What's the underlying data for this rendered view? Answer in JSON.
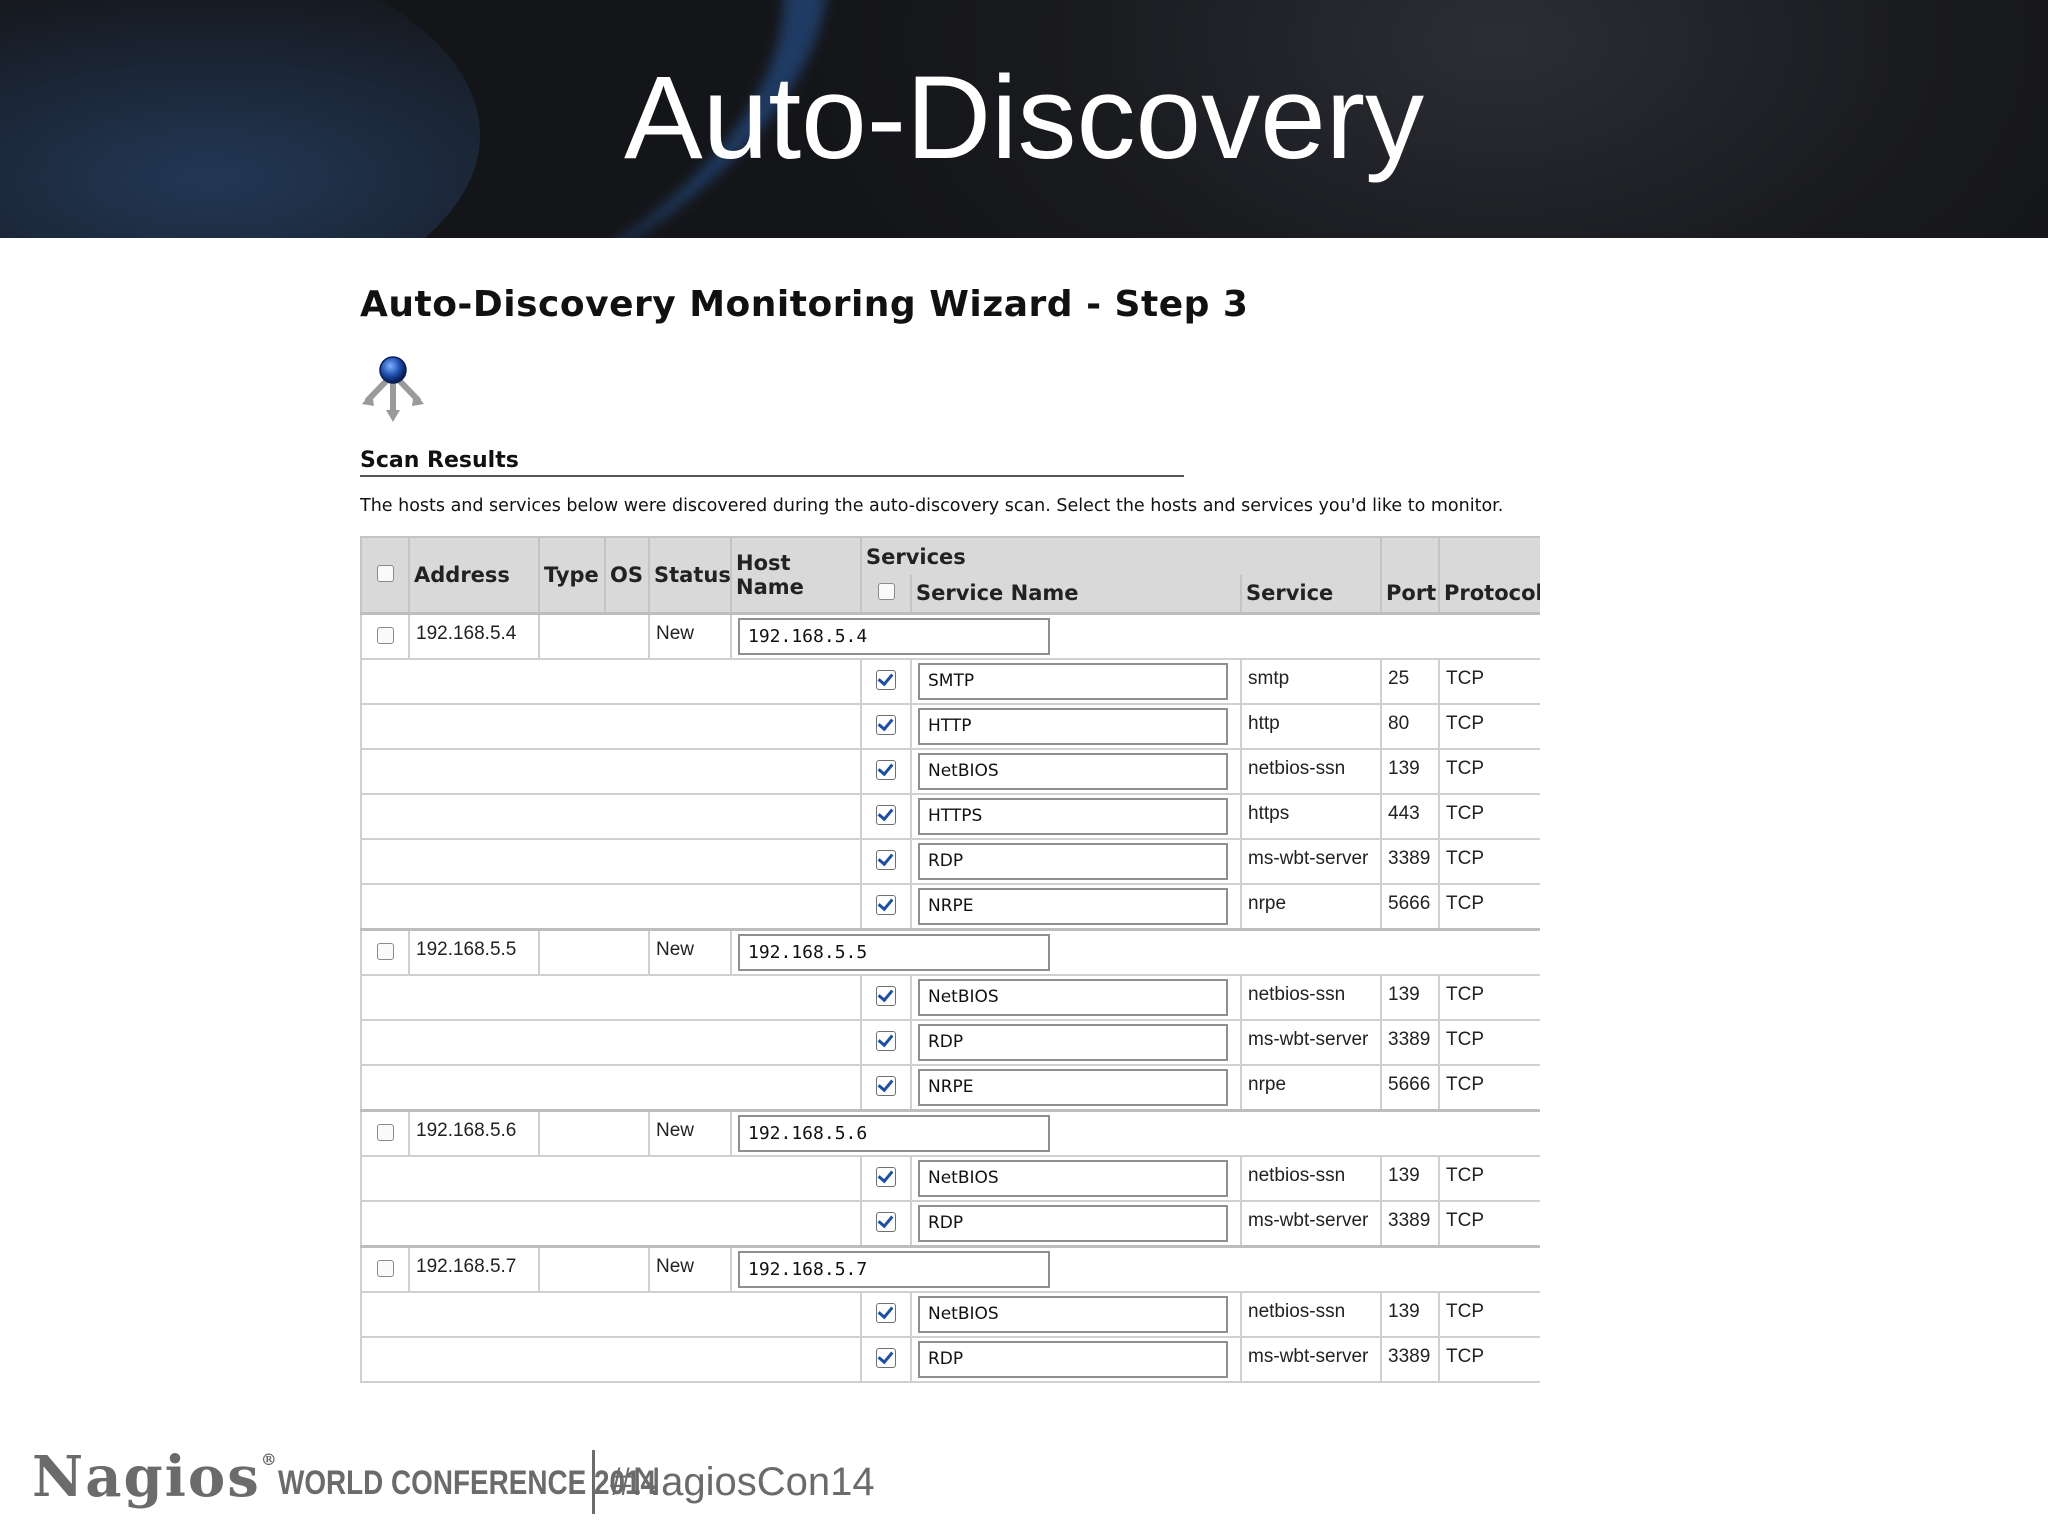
{
  "slide": {
    "title": "Auto-Discovery"
  },
  "wizard": {
    "title": "Auto-Discovery Monitoring Wizard - Step 3",
    "section_title": "Scan Results",
    "description": "The hosts and services below were discovered during the auto-discovery scan. Select the hosts and services you'd like to monitor."
  },
  "table": {
    "headers": {
      "address": "Address",
      "type": "Type",
      "os": "OS",
      "status": "Status",
      "host_name": "Host Name",
      "services": "Services",
      "service_name": "Service Name",
      "service": "Service",
      "port": "Port",
      "protocol": "Protocol"
    },
    "hosts": [
      {
        "address": "192.168.5.4",
        "status": "New",
        "host_name": "192.168.5.4",
        "services": [
          {
            "name": "SMTP",
            "service": "smtp",
            "port": "25",
            "protocol": "TCP"
          },
          {
            "name": "HTTP",
            "service": "http",
            "port": "80",
            "protocol": "TCP"
          },
          {
            "name": "NetBIOS",
            "service": "netbios-ssn",
            "port": "139",
            "protocol": "TCP"
          },
          {
            "name": "HTTPS",
            "service": "https",
            "port": "443",
            "protocol": "TCP"
          },
          {
            "name": "RDP",
            "service": "ms-wbt-server",
            "port": "3389",
            "protocol": "TCP"
          },
          {
            "name": "NRPE",
            "service": "nrpe",
            "port": "5666",
            "protocol": "TCP"
          }
        ]
      },
      {
        "address": "192.168.5.5",
        "status": "New",
        "host_name": "192.168.5.5",
        "services": [
          {
            "name": "NetBIOS",
            "service": "netbios-ssn",
            "port": "139",
            "protocol": "TCP"
          },
          {
            "name": "RDP",
            "service": "ms-wbt-server",
            "port": "3389",
            "protocol": "TCP"
          },
          {
            "name": "NRPE",
            "service": "nrpe",
            "port": "5666",
            "protocol": "TCP"
          }
        ]
      },
      {
        "address": "192.168.5.6",
        "status": "New",
        "host_name": "192.168.5.6",
        "services": [
          {
            "name": "NetBIOS",
            "service": "netbios-ssn",
            "port": "139",
            "protocol": "TCP"
          },
          {
            "name": "RDP",
            "service": "ms-wbt-server",
            "port": "3389",
            "protocol": "TCP"
          }
        ]
      },
      {
        "address": "192.168.5.7",
        "status": "New",
        "host_name": "192.168.5.7",
        "services": [
          {
            "name": "NetBIOS",
            "service": "netbios-ssn",
            "port": "139",
            "protocol": "TCP"
          },
          {
            "name": "RDP",
            "service": "ms-wbt-server",
            "port": "3389",
            "protocol": "TCP"
          }
        ]
      }
    ]
  },
  "footer": {
    "brand": "Nagios",
    "registered": "®",
    "event": "WORLD CONFERENCE 2014",
    "hashtag": "#NagiosCon14"
  },
  "icons": {
    "wizard": "network-discovery-icon"
  }
}
